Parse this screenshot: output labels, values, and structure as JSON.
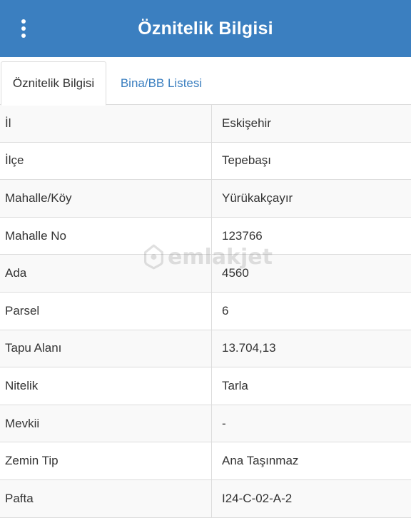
{
  "header": {
    "title": "Öznitelik Bilgisi",
    "menu_icon": "more-vertical-icon"
  },
  "tabs": [
    {
      "label": "Öznitelik Bilgisi",
      "active": true
    },
    {
      "label": "Bina/BB Listesi",
      "active": false
    }
  ],
  "attributes": [
    {
      "label": "İl",
      "value": "Eskişehir"
    },
    {
      "label": "İlçe",
      "value": "Tepebaşı"
    },
    {
      "label": "Mahalle/Köy",
      "value": "Yürükakçayır"
    },
    {
      "label": "Mahalle No",
      "value": "123766"
    },
    {
      "label": "Ada",
      "value": "4560"
    },
    {
      "label": "Parsel",
      "value": "6"
    },
    {
      "label": "Tapu Alanı",
      "value": "13.704,13"
    },
    {
      "label": "Nitelik",
      "value": "Tarla"
    },
    {
      "label": "Mevkii",
      "value": "-"
    },
    {
      "label": "Zemin Tip",
      "value": "Ana Taşınmaz"
    },
    {
      "label": "Pafta",
      "value": "I24-C-02-A-2"
    }
  ],
  "watermark": {
    "text": "emlakjet",
    "icon": "house-pin-icon"
  },
  "colors": {
    "header_bg": "#3b7fc0",
    "tab_link": "#3b7fc0",
    "text": "#333333",
    "border": "#dcdcdc"
  }
}
